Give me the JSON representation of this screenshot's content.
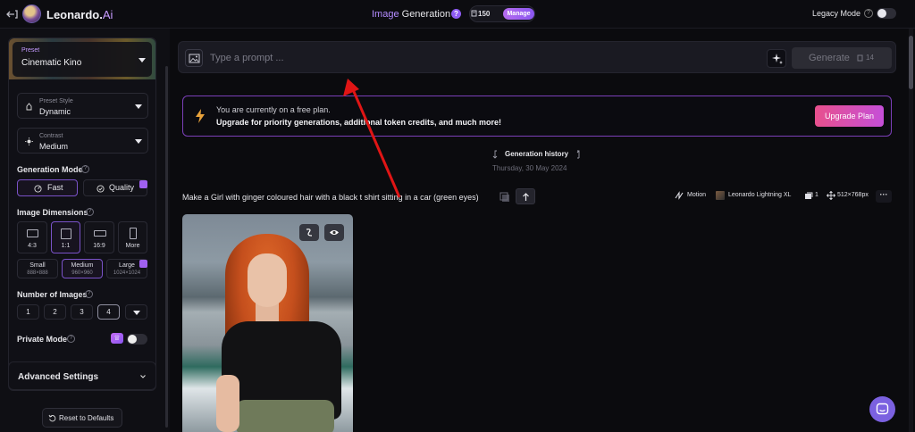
{
  "header": {
    "brand_name": "Leonardo.",
    "brand_suffix": "Ai",
    "title_highlight": "Image",
    "title_rest": " Generation",
    "tokens": "150",
    "manage_label": "Manage",
    "legacy_label": "Legacy Mode",
    "legacy_mode_on": false
  },
  "sidebar": {
    "preset": {
      "label": "Preset",
      "value": "Cinematic Kino"
    },
    "preset_style": {
      "label": "Preset Style",
      "value": "Dynamic"
    },
    "contrast": {
      "label": "Contrast",
      "value": "Medium"
    },
    "generation_mode": {
      "title": "Generation Mode",
      "fast": "Fast",
      "quality": "Quality",
      "selected": "Fast"
    },
    "image_dimensions": {
      "title": "Image Dimensions",
      "ratios": [
        "4:3",
        "1:1",
        "16:9",
        "More"
      ],
      "selected_ratio": "1:1",
      "sizes": [
        {
          "label": "Small",
          "dims": "888×888"
        },
        {
          "label": "Medium",
          "dims": "960×960"
        },
        {
          "label": "Large",
          "dims": "1024×1024"
        }
      ],
      "selected_size": "Medium"
    },
    "number_of_images": {
      "title": "Number of Images",
      "options": [
        "1",
        "2",
        "3",
        "4"
      ],
      "selected": "4"
    },
    "private_mode": {
      "title": "Private Mode",
      "on": false
    },
    "advanced_label": "Advanced Settings",
    "reset_label": "Reset to Defaults"
  },
  "prompt": {
    "placeholder": "Type a prompt ...",
    "value": "",
    "generate_label": "Generate",
    "generate_cost": "14"
  },
  "banner": {
    "line1": "You are currently on a free plan.",
    "line2": "Upgrade for priority generations, additional token credits, and much more!",
    "cta": "Upgrade Plan"
  },
  "history": {
    "title": "Generation history",
    "date": "Thursday, 30 May 2024"
  },
  "generation": {
    "prompt_text": "Make a Girl with ginger coloured hair with a black t shirt sitting in a car (green eyes)",
    "mode": "Motion",
    "model": "Leonardo Lightning XL",
    "count": "1",
    "size": "512×768px",
    "more": "···"
  },
  "colors": {
    "accent": "#8f5cf6",
    "banner_border": "#7b3fb8",
    "upgrade_gradient_start": "#e8508d",
    "upgrade_gradient_end": "#c54fd8",
    "annotation_arrow": "#e01515"
  }
}
